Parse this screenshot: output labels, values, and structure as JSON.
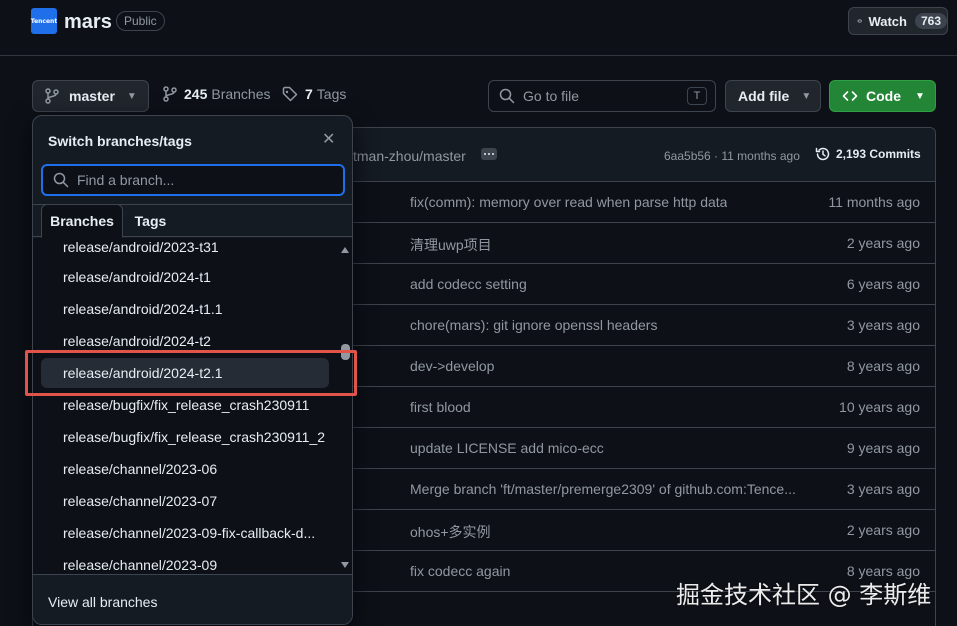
{
  "header": {
    "avatar_text": "Tencent",
    "repo_name": "mars",
    "visibility": "Public",
    "watch_label": "Watch",
    "watch_count": "763"
  },
  "toolbar": {
    "branch_label": "master",
    "branches_count": "245",
    "branches_label": "Branches",
    "tags_count": "7",
    "tags_label": "Tags",
    "goto_placeholder": "Go to file",
    "goto_shortcut": "T",
    "add_file_label": "Add file",
    "code_label": "Code"
  },
  "latest_commit": {
    "author_text": "tman-zhou/master",
    "sha_age": "6aa5b56 · 11 months ago",
    "commits_label": "2,193 Commits"
  },
  "files": [
    {
      "message": "fix(comm): memory over read when parse http data",
      "age": "11 months ago"
    },
    {
      "message": "清理uwp项目",
      "age": "2 years ago"
    },
    {
      "message": "add codecc setting",
      "age": "6 years ago"
    },
    {
      "message": "chore(mars): git ignore openssl headers",
      "age": "3 years ago"
    },
    {
      "message": "dev->develop",
      "age": "8 years ago"
    },
    {
      "message": "first blood",
      "age": "10 years ago"
    },
    {
      "message": "update LICENSE add mico-ecc",
      "age": "9 years ago"
    },
    {
      "message": "Merge branch 'ft/master/premerge2309' of github.com:Tence...",
      "age": "3 years ago"
    },
    {
      "message": "ohos+多实例",
      "age": "2 years ago"
    },
    {
      "message": "fix codecc again",
      "age": "8 years ago"
    }
  ],
  "branch_menu": {
    "title": "Switch branches/tags",
    "filter_placeholder": "Find a branch...",
    "tab_branches": "Branches",
    "tab_tags": "Tags",
    "branches": [
      "release/android/2023-t31",
      "release/android/2024-t1",
      "release/android/2024-t1.1",
      "release/android/2024-t2",
      "release/android/2024-t2.1",
      "release/bugfix/fix_release_crash230911",
      "release/bugfix/fix_release_crash230911_2",
      "release/channel/2023-06",
      "release/channel/2023-07",
      "release/channel/2023-09-fix-callback-d...",
      "release/channel/2023-09"
    ],
    "selected_index": 4,
    "view_all": "View all branches"
  },
  "watermark": "掘金技术社区 @ 李斯维",
  "colors": {
    "background": "#0d1117",
    "accent": "#1f6feb",
    "code_button": "#238636",
    "highlight": "#e0544a"
  }
}
